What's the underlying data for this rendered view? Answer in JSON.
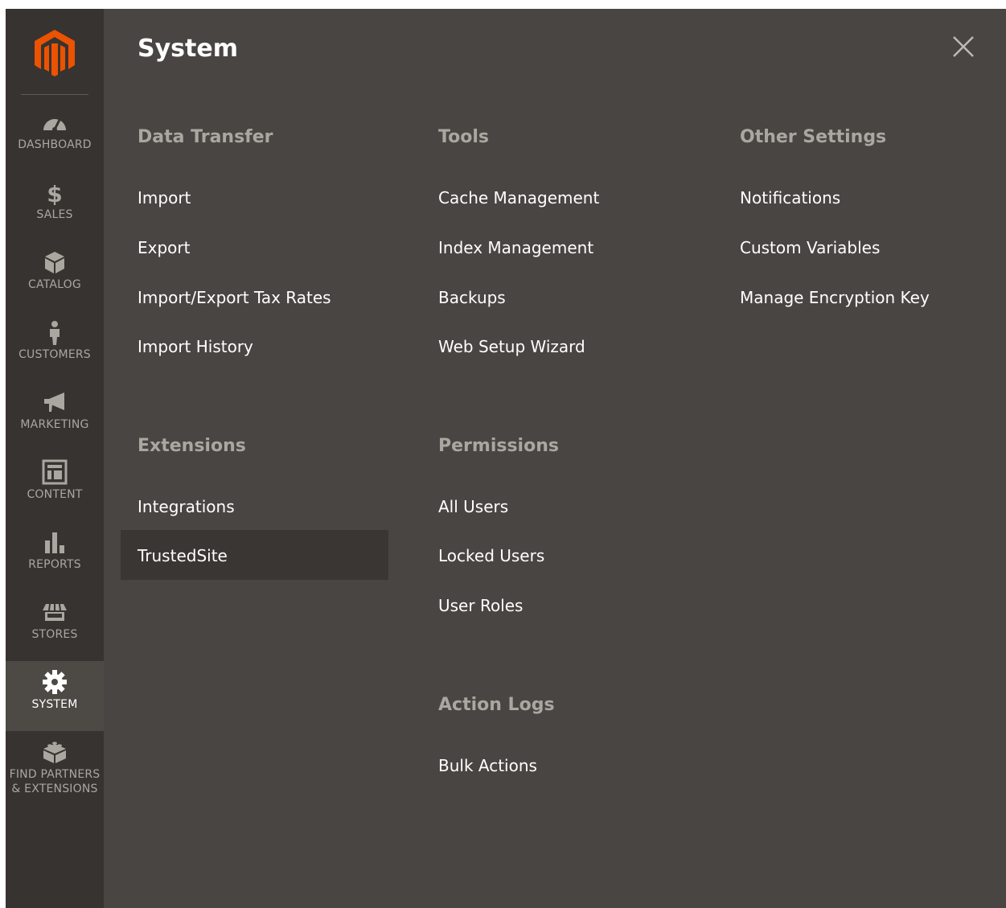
{
  "menu_title": "System",
  "sidebar": {
    "items": [
      {
        "label": "DASHBOARD",
        "icon": "dashboard-icon"
      },
      {
        "label": "SALES",
        "icon": "dollar-icon"
      },
      {
        "label": "CATALOG",
        "icon": "box-icon"
      },
      {
        "label": "CUSTOMERS",
        "icon": "person-icon"
      },
      {
        "label": "MARKETING",
        "icon": "megaphone-icon"
      },
      {
        "label": "CONTENT",
        "icon": "layout-icon"
      },
      {
        "label": "REPORTS",
        "icon": "bar-chart-icon"
      },
      {
        "label": "STORES",
        "icon": "storefront-icon"
      },
      {
        "label": "SYSTEM",
        "icon": "gear-icon",
        "active": true
      },
      {
        "label_line1": "FIND PARTNERS",
        "label_line2": "& EXTENSIONS",
        "icon": "blocks-icon"
      }
    ]
  },
  "sections": {
    "data_transfer": {
      "title": "Data Transfer",
      "links": [
        "Import",
        "Export",
        "Import/Export Tax Rates",
        "Import History"
      ]
    },
    "tools": {
      "title": "Tools",
      "links": [
        "Cache Management",
        "Index Management",
        "Backups",
        "Web Setup Wizard"
      ]
    },
    "other_settings": {
      "title": "Other Settings",
      "links": [
        "Notifications",
        "Custom Variables",
        "Manage Encryption Key"
      ]
    },
    "extensions": {
      "title": "Extensions",
      "links": [
        "Integrations",
        "TrustedSite"
      ]
    },
    "permissions": {
      "title": "Permissions",
      "links": [
        "All Users",
        "Locked Users",
        "User Roles"
      ]
    },
    "action_logs": {
      "title": "Action Logs",
      "links": [
        "Bulk Actions"
      ]
    }
  },
  "highlighted_link": "TrustedSite",
  "colors": {
    "sidebar": "#373330",
    "panel": "#494542",
    "logo": "#eb5202",
    "highlight": "#3a3633"
  }
}
